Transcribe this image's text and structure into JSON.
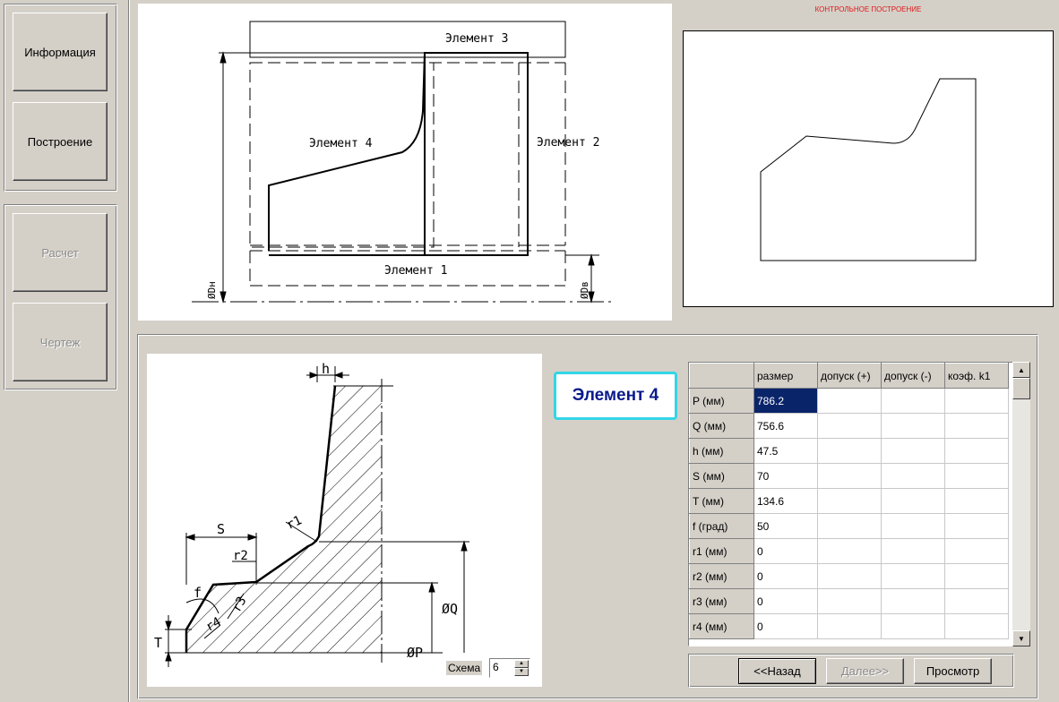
{
  "sidebar": {
    "info_label": "Информация",
    "build_label": "Построение",
    "calc_label": "Расчет",
    "drawing_label": "Чертеж"
  },
  "control_title": "КОНТРОЛЬНОЕ ПОСТРОЕНИЕ",
  "top_drawing": {
    "element1": "Элемент 1",
    "element2": "Элемент 2",
    "element3": "Элемент 3",
    "element4": "Элемент 4",
    "dim_outer": "ØDн",
    "dim_inner": "ØDв"
  },
  "detail_drawing": {
    "h": "h",
    "s": "S",
    "r1": "r1",
    "r2": "r2",
    "r3": "r3",
    "r4": "r4",
    "f": "f",
    "t": "T",
    "q": "ØQ",
    "p": "ØP"
  },
  "scheme": {
    "label": "Схема",
    "value": "6"
  },
  "element_badge": "Элемент 4",
  "table": {
    "columns": [
      "",
      "размер",
      "допуск (+)",
      "допуск (-)",
      "коэф. k1"
    ],
    "rows": [
      [
        "P (мм)",
        "786.2",
        "",
        "",
        ""
      ],
      [
        "Q (мм)",
        "756.6",
        "",
        "",
        ""
      ],
      [
        "h (мм)",
        "47.5",
        "",
        "",
        ""
      ],
      [
        "S (мм)",
        "70",
        "",
        "",
        ""
      ],
      [
        "T (мм)",
        "134.6",
        "",
        "",
        ""
      ],
      [
        "f (град)",
        "50",
        "",
        "",
        ""
      ],
      [
        "r1 (мм)",
        "0",
        "",
        "",
        ""
      ],
      [
        "r2 (мм)",
        "0",
        "",
        "",
        ""
      ],
      [
        "r3 (мм)",
        "0",
        "",
        "",
        ""
      ],
      [
        "r4 (мм)",
        "0",
        "",
        "",
        ""
      ]
    ]
  },
  "nav": {
    "back_label": "<<Назад",
    "next_label": "Далее>>",
    "preview_label": "Просмотр"
  },
  "colors": {
    "window_bg": "#d4d0c8",
    "title_red": "#e01818",
    "badge_text": "#0a1a8a",
    "badge_border": "#33d6e6",
    "selection": "#0a246a"
  }
}
